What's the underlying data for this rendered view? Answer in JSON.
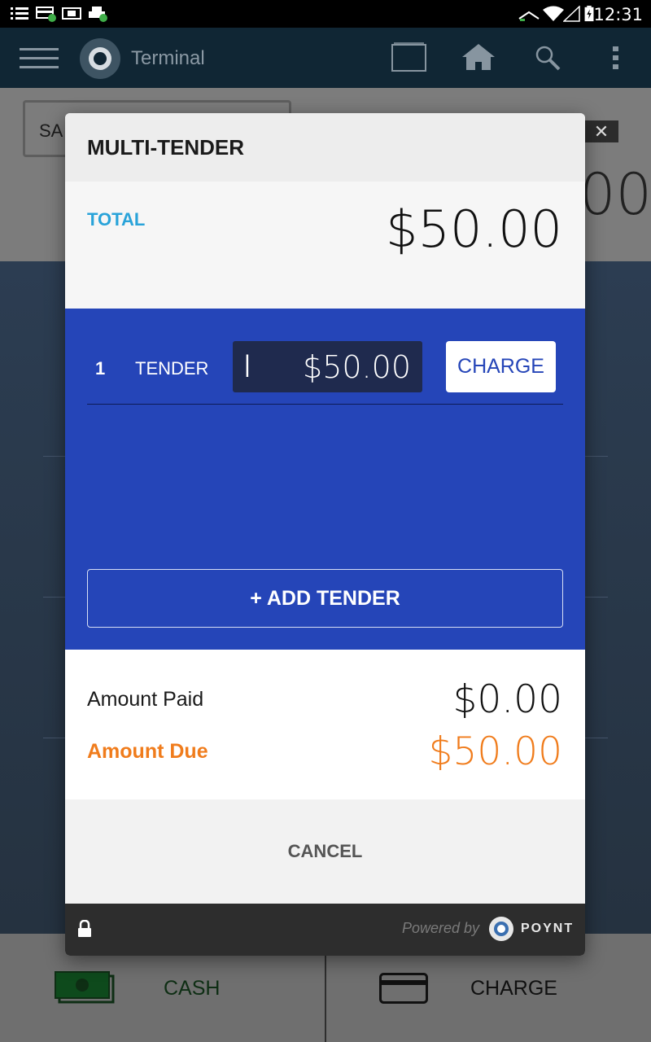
{
  "status_bar": {
    "time": "12:31",
    "icons": [
      "list-icon",
      "card-check-icon",
      "cash-check-icon",
      "printer-check-icon",
      "signal-icon",
      "wifi-icon",
      "cell-icon",
      "battery-charging-icon"
    ]
  },
  "app_bar": {
    "title": "Terminal",
    "icons": [
      "menu-icon",
      "poynt-logo-icon",
      "window-icon",
      "home-icon",
      "search-icon",
      "overflow-menu-icon"
    ]
  },
  "background": {
    "sale_label": "SA",
    "amount_partial": "00",
    "close_glyph": "✕",
    "bottom": {
      "cash_label": "CASH",
      "charge_label": "CHARGE"
    }
  },
  "dialog": {
    "title": "MULTI-TENDER",
    "total_label": "TOTAL",
    "total_amount": "$50.00",
    "tenders": [
      {
        "index": "1",
        "label": "TENDER",
        "amount": "$50.00",
        "charge_label": "CHARGE"
      }
    ],
    "add_tender_label": "+ ADD TENDER",
    "amount_paid_label": "Amount Paid",
    "amount_paid_value": "$0.00",
    "amount_due_label": "Amount Due",
    "amount_due_value": "$50.00",
    "cancel_label": "CANCEL",
    "footer": {
      "powered_by": "Powered by",
      "brand": "POYNT"
    }
  },
  "colors": {
    "total_label": "#29a3d9",
    "tender_panel": "#2545b8",
    "amount_due": "#f07c1c",
    "app_bar": "#102634"
  }
}
